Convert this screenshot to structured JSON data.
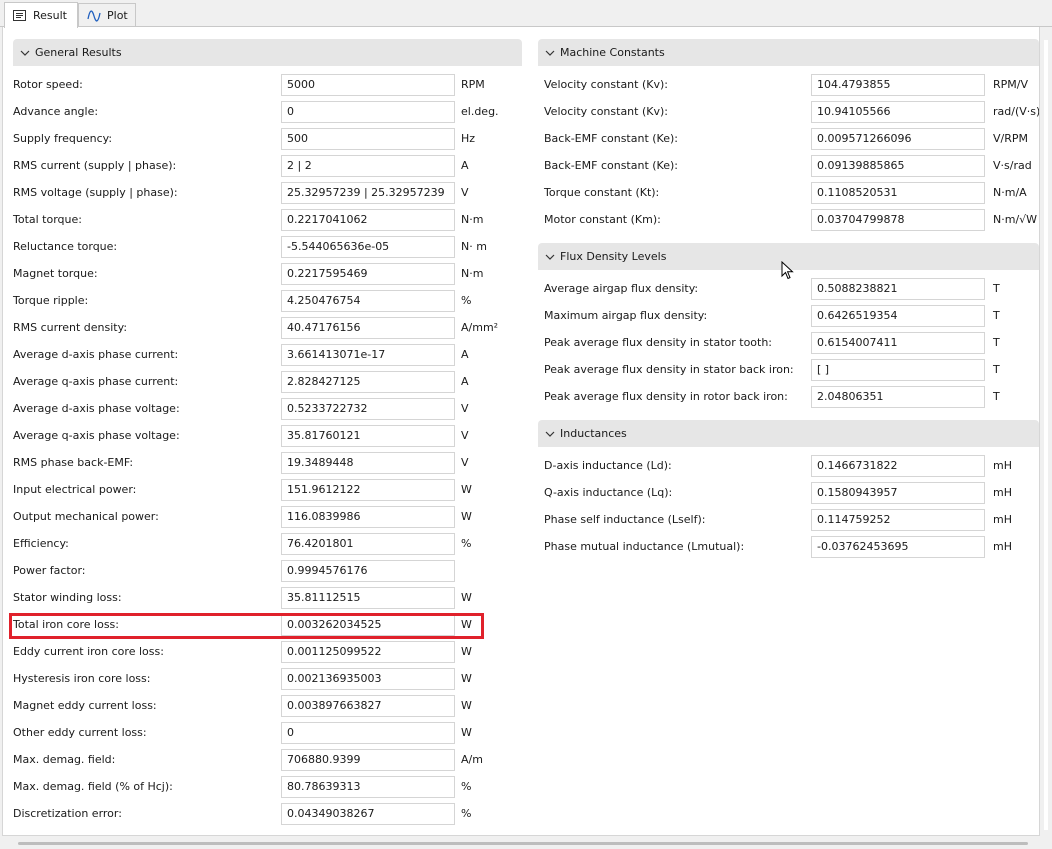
{
  "tabs": [
    {
      "label": "Result",
      "icon": "document-icon",
      "active": true
    },
    {
      "label": "Plot",
      "icon": "waveform-icon",
      "active": false
    }
  ],
  "general": {
    "title": "General Results",
    "rows": [
      {
        "label": "Rotor speed:",
        "value": "5000",
        "unit": "RPM"
      },
      {
        "label": "Advance angle:",
        "value": "0",
        "unit": "el.deg."
      },
      {
        "label": "Supply frequency:",
        "value": "500",
        "unit": "Hz"
      },
      {
        "label": "RMS current (supply | phase):",
        "value": "2 | 2",
        "unit": "A"
      },
      {
        "label": "RMS voltage (supply | phase):",
        "value": "25.32957239 | 25.32957239",
        "unit": "V"
      },
      {
        "label": "Total torque:",
        "value": "0.2217041062",
        "unit": "N·m"
      },
      {
        "label": "Reluctance torque:",
        "value": "-5.544065636e-05",
        "unit": "N· m"
      },
      {
        "label": "Magnet torque:",
        "value": "0.2217595469",
        "unit": "N·m"
      },
      {
        "label": "Torque ripple:",
        "value": "4.250476754",
        "unit": "%"
      },
      {
        "label": "RMS current density:",
        "value": "40.47176156",
        "unit": "A/mm²"
      },
      {
        "label": "Average d-axis phase current:",
        "value": "3.661413071e-17",
        "unit": "A"
      },
      {
        "label": "Average q-axis phase current:",
        "value": "2.828427125",
        "unit": "A"
      },
      {
        "label": "Average d-axis phase voltage:",
        "value": "0.5233722732",
        "unit": "V"
      },
      {
        "label": "Average q-axis phase voltage:",
        "value": "35.81760121",
        "unit": "V"
      },
      {
        "label": "RMS phase back-EMF:",
        "value": "19.3489448",
        "unit": "V"
      },
      {
        "label": "Input electrical power:",
        "value": "151.9612122",
        "unit": "W"
      },
      {
        "label": "Output mechanical power:",
        "value": "116.0839986",
        "unit": "W"
      },
      {
        "label": "Efficiency:",
        "value": "76.4201801",
        "unit": "%"
      },
      {
        "label": "Power factor:",
        "value": "0.9994576176",
        "unit": ""
      },
      {
        "label": "Stator winding loss:",
        "value": "35.81112515",
        "unit": "W"
      },
      {
        "label": "Total iron core loss:",
        "value": "0.003262034525",
        "unit": "W"
      },
      {
        "label": "Eddy current iron core loss:",
        "value": "0.001125099522",
        "unit": "W"
      },
      {
        "label": "Hysteresis iron core loss:",
        "value": "0.002136935003",
        "unit": "W"
      },
      {
        "label": "Magnet eddy current loss:",
        "value": "0.003897663827",
        "unit": "W"
      },
      {
        "label": "Other eddy current loss:",
        "value": "0",
        "unit": "W"
      },
      {
        "label": "Max. demag. field:",
        "value": "706880.9399",
        "unit": "A/m"
      },
      {
        "label": "Max. demag. field (% of Hcj):",
        "value": "80.78639313",
        "unit": "%"
      },
      {
        "label": "Discretization error:",
        "value": "0.04349038267",
        "unit": "%"
      }
    ]
  },
  "machine": {
    "title": "Machine Constants",
    "rows": [
      {
        "label": "Velocity constant (Kv):",
        "value": "104.4793855",
        "unit": "RPM/V"
      },
      {
        "label": "Velocity constant (Kv):",
        "value": "10.94105566",
        "unit": "rad/(V·s)"
      },
      {
        "label": "Back-EMF constant (Ke):",
        "value": "0.009571266096",
        "unit": "V/RPM"
      },
      {
        "label": "Back-EMF constant (Ke):",
        "value": "0.09139885865",
        "unit": "V·s/rad"
      },
      {
        "label": "Torque constant (Kt):",
        "value": "0.1108520531",
        "unit": "N·m/A"
      },
      {
        "label": "Motor constant (Km):",
        "value": "0.03704799878",
        "unit": "N·m/√W"
      }
    ]
  },
  "flux": {
    "title": "Flux Density Levels",
    "rows": [
      {
        "label": "Average airgap flux density:",
        "value": "0.5088238821",
        "unit": "T"
      },
      {
        "label": "Maximum airgap flux density:",
        "value": "0.6426519354",
        "unit": "T"
      },
      {
        "label": "Peak average flux density in stator tooth:",
        "value": "0.6154007411",
        "unit": "T"
      },
      {
        "label": "Peak average flux density in stator back iron:",
        "value": "[ ]",
        "unit": "T"
      },
      {
        "label": "Peak average flux density in rotor back iron:",
        "value": "2.04806351",
        "unit": "T"
      }
    ]
  },
  "inductances": {
    "title": "Inductances",
    "rows": [
      {
        "label": "D-axis inductance (Ld):",
        "value": "0.1466731822",
        "unit": "mH"
      },
      {
        "label": "Q-axis inductance (Lq):",
        "value": "0.1580943957",
        "unit": "mH"
      },
      {
        "label": "Phase self inductance (Lself):",
        "value": "0.114759252",
        "unit": "mH"
      },
      {
        "label": "Phase mutual inductance (Lmutual):",
        "value": "-0.03762453695",
        "unit": "mH"
      }
    ]
  },
  "highlight_color": "#e0212b"
}
